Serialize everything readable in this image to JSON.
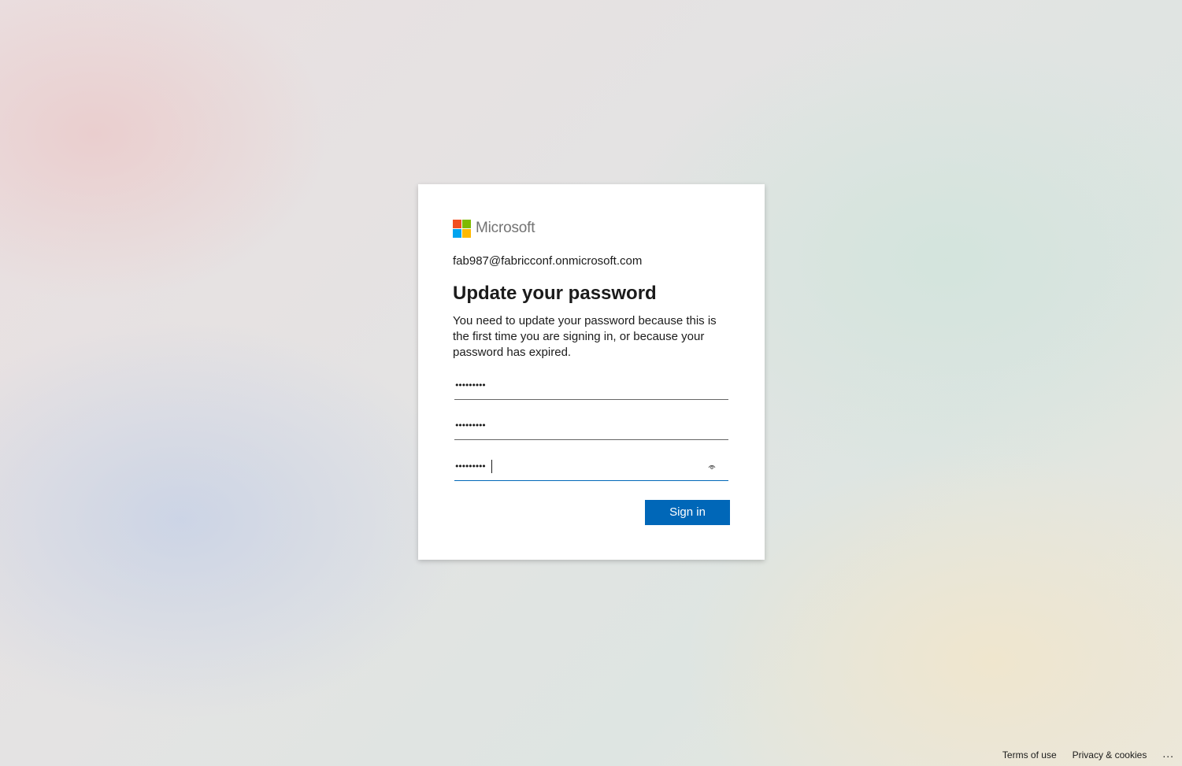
{
  "logo": {
    "text": "Microsoft",
    "colors": [
      "#f25022",
      "#7fba00",
      "#00a4ef",
      "#ffb900"
    ]
  },
  "identity": "fab987@fabricconf.onmicrosoft.com",
  "title": "Update your password",
  "description": "You need to update your password because this is the first time you are signing in, or because your password has expired.",
  "fields": [
    {
      "value": "•••••••••",
      "type": "password",
      "focused": false
    },
    {
      "value": "•••••••••",
      "type": "password",
      "focused": false
    },
    {
      "value": "•••••••••",
      "type": "password",
      "focused": true,
      "reveal_icon": "eye-icon"
    }
  ],
  "buttons": {
    "sign_in": "Sign in"
  },
  "footer": {
    "terms": "Terms of use",
    "privacy": "Privacy & cookies",
    "more": "..."
  },
  "colors": {
    "accent": "#0067b8",
    "text": "#1b1b1b",
    "logo_text": "#737373"
  }
}
